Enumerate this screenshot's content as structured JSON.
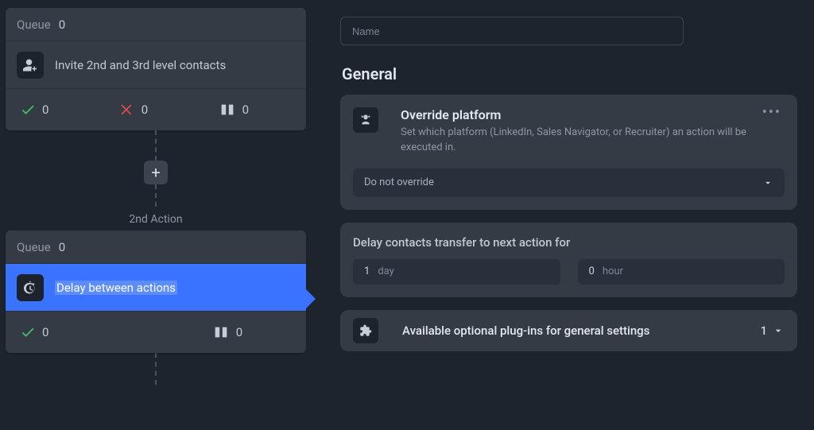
{
  "workflow": {
    "action1": {
      "queue_label": "Queue",
      "queue_count": "0",
      "title": "Invite 2nd and 3rd level contacts",
      "stat_success": "0",
      "stat_fail": "0",
      "stat_other": "0"
    },
    "add_label": "+",
    "action2_index": "2nd Action",
    "action2": {
      "queue_label": "Queue",
      "queue_count": "0",
      "title": "Delay between actions",
      "stat_success": "0",
      "stat_other": "0"
    }
  },
  "settings": {
    "name_placeholder": "Name",
    "general_heading": "General",
    "override": {
      "title": "Override platform",
      "desc": "Set which platform (LinkedIn, Sales Navigator, or Recruiter) an action will be executed in.",
      "select_value": "Do not override"
    },
    "delay": {
      "title": "Delay contacts transfer to next action for",
      "days_value": "1",
      "days_unit": "day",
      "hours_value": "0",
      "hours_unit": "hour"
    },
    "plugins": {
      "title": "Available optional plug-ins for general settings",
      "count": "1"
    }
  }
}
